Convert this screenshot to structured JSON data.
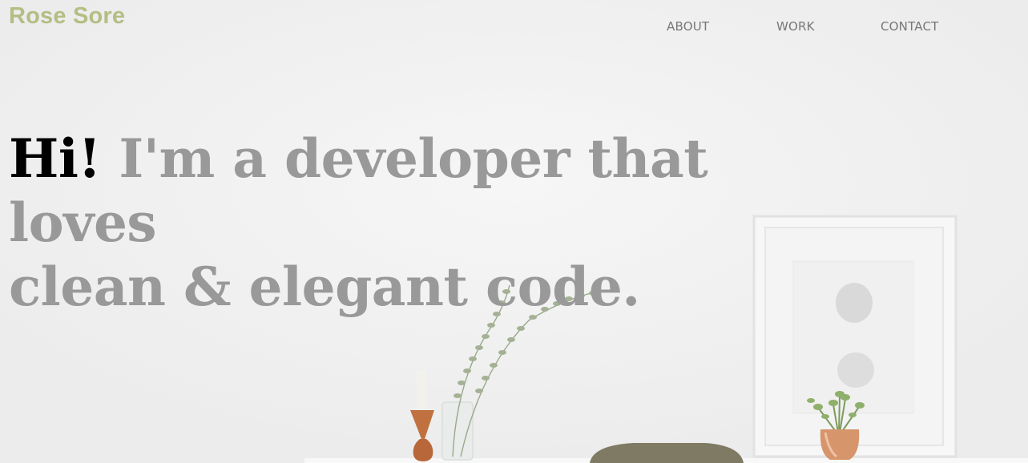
{
  "header": {
    "logo_text": "Rose Sore",
    "nav": [
      {
        "label": "ABOUT"
      },
      {
        "label": "WORK"
      },
      {
        "label": "CONTACT"
      }
    ]
  },
  "hero": {
    "greeting": "Hi!",
    "tagline_line1": " I'm a developer that loves",
    "tagline_line2": "clean & elegant code."
  },
  "colors": {
    "logo": "#b5bd84",
    "nav_text": "#777777",
    "headline_muted": "#999999",
    "headline_accent": "#000000",
    "background": "#eeeeee"
  },
  "icons": {
    "background_photo": "desk-with-plants-and-frame-photo"
  }
}
